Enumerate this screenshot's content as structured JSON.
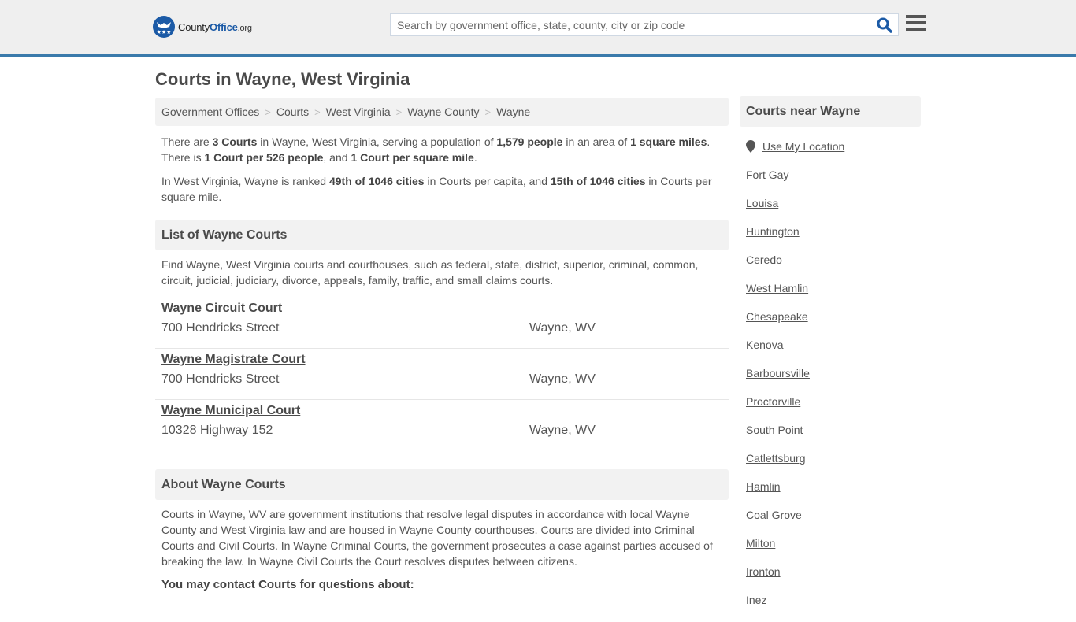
{
  "header": {
    "logo": {
      "name_part1": "County",
      "name_part2": "Office",
      "tld": ".org"
    },
    "search": {
      "placeholder": "Search by government office, state, county, city or zip code",
      "value": ""
    },
    "icons": {
      "search": "search-icon",
      "menu": "hamburger-menu-icon"
    }
  },
  "page": {
    "title": "Courts in Wayne, West Virginia"
  },
  "breadcrumb": [
    {
      "label": "Government Offices"
    },
    {
      "label": "Courts"
    },
    {
      "label": "West Virginia"
    },
    {
      "label": "Wayne County"
    },
    {
      "label": "Wayne"
    }
  ],
  "breadcrumb_separator": ">",
  "summary": {
    "p1": {
      "t1": "There are ",
      "b1": "3 Courts",
      "t2": " in Wayne, West Virginia, serving a population of ",
      "b2": "1,579 people",
      "t3": " in an area of ",
      "b3": "1 square miles",
      "t4": ". There is ",
      "b4": "1 Court per 526 people",
      "t5": ", and ",
      "b5": "1 Court per square mile",
      "t6": "."
    },
    "p2": {
      "t1": "In West Virginia, Wayne is ranked ",
      "b1": "49th of 1046 cities",
      "t2": " in Courts per capita, and ",
      "b2": "15th of 1046 cities",
      "t3": " in Courts per square mile."
    }
  },
  "list_section": {
    "heading": "List of Wayne Courts",
    "intro": "Find Wayne, West Virginia courts and courthouses, such as federal, state, district, superior, criminal, common, circuit, judicial, judiciary, divorce, appeals, family, traffic, and small claims courts.",
    "courts": [
      {
        "name": "Wayne Circuit Court",
        "address": "700 Hendricks Street",
        "city": "Wayne, WV"
      },
      {
        "name": "Wayne Magistrate Court",
        "address": "700 Hendricks Street",
        "city": "Wayne, WV"
      },
      {
        "name": "Wayne Municipal Court",
        "address": "10328 Highway 152",
        "city": "Wayne, WV"
      }
    ]
  },
  "about_section": {
    "heading": "About Wayne Courts",
    "body": "Courts in Wayne, WV are government institutions that resolve legal disputes in accordance with local Wayne County and West Virginia law and are housed in Wayne County courthouses. Courts are divided into Criminal Courts and Civil Courts. In Wayne Criminal Courts, the government prosecutes a case against parties accused of breaking the law. In Wayne Civil Courts the Court resolves disputes between citizens.",
    "contact_heading": "You may contact Courts for questions about:"
  },
  "sidebar": {
    "heading": "Courts near Wayne",
    "use_location": "Use My Location",
    "nearby": [
      "Fort Gay",
      "Louisa",
      "Huntington",
      "Ceredo",
      "West Hamlin",
      "Chesapeake",
      "Kenova",
      "Barboursville",
      "Proctorville",
      "South Point",
      "Catlettsburg",
      "Hamlin",
      "Coal Grove",
      "Milton",
      "Ironton",
      "Inez"
    ]
  },
  "colors": {
    "accent": "#3a7aab",
    "brand": "#1b5aa6",
    "header_bg": "#efefef",
    "panel_bg": "#f2f2f2",
    "text": "#555555"
  }
}
